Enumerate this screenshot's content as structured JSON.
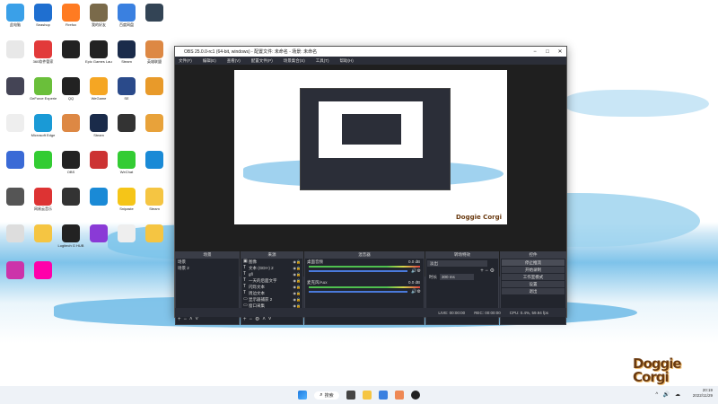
{
  "desktop": {
    "icons": [
      {
        "label": "此电脑",
        "color": "#3aa0e8"
      },
      {
        "label": "Seashop",
        "color": "#1f6fd0"
      },
      {
        "label": "Firefox",
        "color": "#ff7b22"
      },
      {
        "label": "我的好友",
        "color": "#7a6a4a"
      },
      {
        "label": "百度网盘",
        "color": "#3a80e0"
      },
      {
        "label": "",
        "color": "#345"
      },
      {
        "label": "",
        "color": "#e8e8e8"
      },
      {
        "label": "360软件管家",
        "color": "#e23a3a"
      },
      {
        "label": "",
        "color": "#222"
      },
      {
        "label": "Epic Games Launcher",
        "color": "#222"
      },
      {
        "label": "Steam",
        "color": "#1a2b4a"
      },
      {
        "label": "英雄联盟",
        "color": "#d84"
      },
      {
        "label": "",
        "color": "#445"
      },
      {
        "label": "GeForce Experience",
        "color": "#6abf3a"
      },
      {
        "label": "QQ",
        "color": "#222"
      },
      {
        "label": "WeGame",
        "color": "#f5a623"
      },
      {
        "label": "SE",
        "color": "#2a4a8a"
      },
      {
        "label": "",
        "color": "#e89a2a"
      },
      {
        "label": "",
        "color": "#eee"
      },
      {
        "label": "Microsoft Edge",
        "color": "#1a9ad6"
      },
      {
        "label": "",
        "color": "#d84"
      },
      {
        "label": "Steam",
        "color": "#1a2b4a"
      },
      {
        "label": "",
        "color": "#333"
      },
      {
        "label": "",
        "color": "#e8a23a"
      },
      {
        "label": "",
        "color": "#3a6ad6"
      },
      {
        "label": "",
        "color": "#3c3"
      },
      {
        "label": "OBS",
        "color": "#222"
      },
      {
        "label": "",
        "color": "#c33"
      },
      {
        "label": "WeChat",
        "color": "#3c3"
      },
      {
        "label": "",
        "color": "#1a8ad6"
      },
      {
        "label": "",
        "color": "#555"
      },
      {
        "label": "网易云音乐",
        "color": "#d33"
      },
      {
        "label": "",
        "color": "#333"
      },
      {
        "label": "",
        "color": "#1a8ad6"
      },
      {
        "label": "Snipaste",
        "color": "#f5c518"
      },
      {
        "label": "Steam",
        "color": "#f5c542"
      },
      {
        "label": "",
        "color": "#ddd"
      },
      {
        "label": "",
        "color": "#f5c542"
      },
      {
        "label": "Logitech G HUB",
        "color": "#222"
      },
      {
        "label": "",
        "color": "#8a3ad6"
      },
      {
        "label": "",
        "color": "#eee"
      },
      {
        "label": "",
        "color": "#f5c542"
      },
      {
        "label": "",
        "color": "#c3a"
      },
      {
        "label": "",
        "color": "#f0a"
      }
    ]
  },
  "obs": {
    "title": "OBS 25.0.0-rc1 (64-bit, windows) - 配置文件: 未命名 - 场景: 未命名",
    "menu": [
      "文件(F)",
      "编辑(E)",
      "查看(V)",
      "配置文件(P)",
      "场景集合(S)",
      "工具(T)",
      "帮助(H)"
    ],
    "scenes_header": "场景",
    "scenes": [
      "场景",
      "场景 2"
    ],
    "sources_header": "来源",
    "sources": [
      {
        "icon": "▣",
        "label": "图像"
      },
      {
        "icon": "T",
        "label": "文本 (GDI+) 2"
      },
      {
        "icon": "T",
        "label": "gfl"
      },
      {
        "icon": "T",
        "label": "一天的后面文字"
      },
      {
        "icon": "T",
        "label": "闪烁文本"
      },
      {
        "icon": "T",
        "label": "周边文本"
      },
      {
        "icon": "▭",
        "label": "显示器捕获 2"
      },
      {
        "icon": "▭",
        "label": "窗口采集"
      }
    ],
    "mixer_header": "混音器",
    "mixer": [
      {
        "label": "桌面音频",
        "db": "0.0 dB"
      },
      {
        "label": "麦克风/Aux",
        "db": "0.0 dB"
      }
    ],
    "transitions_header": "转场特效",
    "transition_value": "淡出",
    "duration_label": "时长",
    "duration_value": "300 ms",
    "controls_header": "控件",
    "controls": [
      "停止推流",
      "开始录制",
      "工作室模式",
      "设置",
      "退出"
    ],
    "status": {
      "live": "LIVE: 00:00:00",
      "rec": "REC: 00:00:00",
      "cpu": "CPU: 0.4%, 59.94 fps"
    }
  },
  "taskbar": {
    "search_label": "搜索",
    "time": "20:19",
    "date": "2022/11/29"
  },
  "watermark": "Doggie Corgi"
}
